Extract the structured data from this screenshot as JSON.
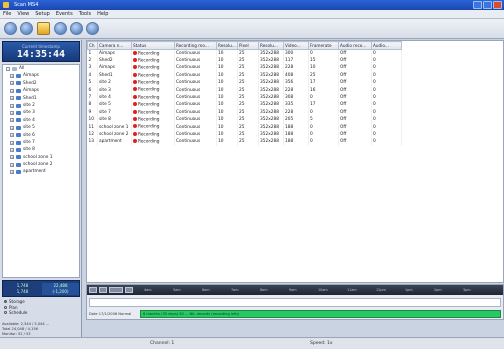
{
  "window": {
    "title": "Scan MS4"
  },
  "menu": [
    "File",
    "View",
    "Setup",
    "Events",
    "Tools",
    "Help"
  ],
  "toolbar": [
    "record-icon",
    "stop-icon",
    "schedule-icon",
    "refresh-icon",
    "settings-icon",
    "save-icon"
  ],
  "clock": {
    "label": "Current timestamp",
    "time": "14:35:44"
  },
  "tree": {
    "root": "All",
    "items": [
      "Aimaps",
      "Shed2",
      "Aimaps",
      "Shed1",
      "site 2",
      "site 3",
      "site 4",
      "site 5",
      "site 6",
      "site 7",
      "site 8",
      "school zone 1",
      "school zone 2",
      "apartment"
    ]
  },
  "stats": {
    "left": [
      "1,748",
      "1,748"
    ],
    "right": [
      "22,488",
      "(-1,200)"
    ]
  },
  "options": [
    "Storage",
    "Plan",
    "Schedule"
  ],
  "info": [
    "Available: 2,344 / 5,044 ...",
    "Total 24,048 / 4,156",
    "Monitor: 52 / 53"
  ],
  "table": {
    "columns": [
      "Ch",
      "Camera n...",
      "Status",
      "Recording mo...",
      "Resolu...",
      "Pixel",
      "Resolu...",
      "Video...",
      "Framerate",
      "Audio reco...",
      "Audio..."
    ],
    "rows": [
      [
        "1",
        "Aimaps",
        "Recording",
        "Continuous",
        "10",
        "25",
        "352x288",
        "300",
        "0",
        "Off",
        "0"
      ],
      [
        "2",
        "Shed2",
        "Recording",
        "Continuous",
        "10",
        "25",
        "352x288",
        "117",
        "15",
        "Off",
        "0"
      ],
      [
        "3",
        "Aimaps",
        "Recording",
        "Continuous",
        "10",
        "25",
        "352x288",
        "228",
        "10",
        "Off",
        "0"
      ],
      [
        "4",
        "Shed1",
        "Recording",
        "Continuous",
        "10",
        "25",
        "352x288",
        "408",
        "25",
        "Off",
        "0"
      ],
      [
        "5",
        "site 2",
        "Recording",
        "Continuous",
        "10",
        "25",
        "352x288",
        "356",
        "17",
        "Off",
        "0"
      ],
      [
        "6",
        "site 3",
        "Recording",
        "Continuous",
        "10",
        "25",
        "352x288",
        "228",
        "16",
        "Off",
        "0"
      ],
      [
        "7",
        "site 4",
        "Recording",
        "Continuous",
        "10",
        "25",
        "352x288",
        "308",
        "0",
        "Off",
        "0"
      ],
      [
        "8",
        "site 5",
        "Recording",
        "Continuous",
        "10",
        "25",
        "352x288",
        "335",
        "17",
        "Off",
        "0"
      ],
      [
        "9",
        "site 7",
        "Recording",
        "Continuous",
        "10",
        "25",
        "352x288",
        "228",
        "0",
        "Off",
        "0"
      ],
      [
        "10",
        "site 8",
        "Recording",
        "Continuous",
        "10",
        "25",
        "352x288",
        "205",
        "5",
        "Off",
        "0"
      ],
      [
        "11",
        "school zone 1",
        "Recording",
        "Continuous",
        "10",
        "25",
        "352x288",
        "188",
        "0",
        "Off",
        "0"
      ],
      [
        "12",
        "school zone 2",
        "Recording",
        "Continuous",
        "10",
        "25",
        "352x288",
        "188",
        "0",
        "Off",
        "0"
      ],
      [
        "13",
        "apartment",
        "Recording",
        "Continuous",
        "10",
        "25",
        "352x288",
        "188",
        "0",
        "Off",
        "0"
      ]
    ]
  },
  "timeline": {
    "ticks": [
      "4am",
      "5am",
      "6am",
      "7am",
      "8am",
      "9am",
      "10am",
      "11am",
      "12pm",
      "1pm",
      "2pm",
      "3pm"
    ],
    "left_label": "Date 17/1/2006 Normal",
    "bar_label": "6 months (35 days) 50 ...   Nb. records (recording info)"
  },
  "statusbar": {
    "left": "Channel: 1",
    "right": "Speed: 1x"
  },
  "colors": {
    "accent": "#1c47b2",
    "record": "#e02020",
    "timeline": "#28c864"
  }
}
